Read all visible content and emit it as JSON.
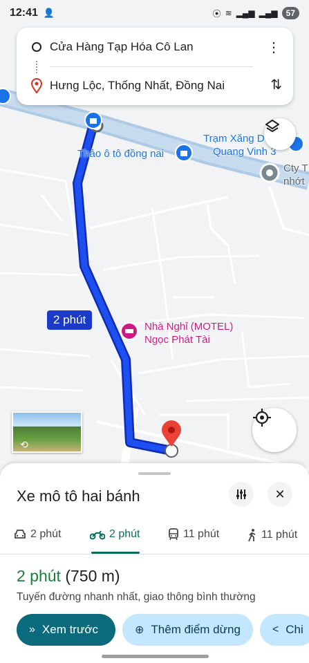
{
  "status_bar": {
    "time": "12:41",
    "battery": "57"
  },
  "directions": {
    "origin": "Cửa Hàng Tạp Hóa Cô Lan",
    "destination": "Hưng Lộc, Thống Nhất, Đồng Nai"
  },
  "map": {
    "pois": {
      "thao_oto": "Thảo ô tô đồng nai",
      "tram_xang_line1": "Trạm Xăng D",
      "tram_xang_line2": "Quang Vinh 3",
      "cty_line1": "Cty T",
      "cty_line2": "nhớt",
      "motel_line1": "Nhà Nghỉ (MOTEL)",
      "motel_line2": "Ngọc Phát Tài"
    },
    "route_badge": "2 phút",
    "colors": {
      "route": "#1a3ac7",
      "destination_pin": "#ea4335",
      "poi_blue": "#1a73e8",
      "poi_pink": "#d01884"
    }
  },
  "sheet": {
    "title": "Xe mô tô hai bánh",
    "modes": [
      {
        "label": "2 phút",
        "icon": "car-icon"
      },
      {
        "label": "2 phút",
        "icon": "motorbike-icon"
      },
      {
        "label": "11 phút",
        "icon": "transit-icon"
      },
      {
        "label": "11 phút",
        "icon": "walk-icon"
      }
    ],
    "active_mode": 1,
    "eta_time": "2 phút",
    "eta_distance": "(750 m)",
    "summary": "Tuyến đường nhanh nhất, giao thông bình thường",
    "actions": {
      "preview": "Xem trước",
      "add_stop": "Thêm điểm dừng",
      "share": "Chi"
    }
  }
}
